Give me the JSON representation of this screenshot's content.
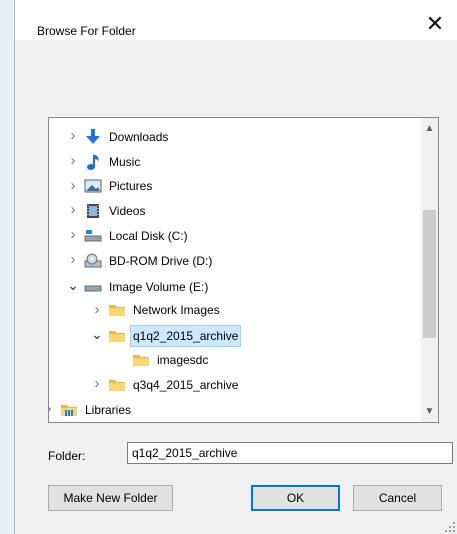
{
  "dialog": {
    "title": "Browse For Folder",
    "close_glyph": "✕"
  },
  "tree": {
    "items": [
      {
        "label": "Downloads",
        "icon": "downloads-icon",
        "level": 1,
        "expanded": false,
        "selected": false
      },
      {
        "label": "Music",
        "icon": "music-icon",
        "level": 1,
        "expanded": false,
        "selected": false
      },
      {
        "label": "Pictures",
        "icon": "pictures-icon",
        "level": 1,
        "expanded": false,
        "selected": false
      },
      {
        "label": "Videos",
        "icon": "videos-icon",
        "level": 1,
        "expanded": false,
        "selected": false
      },
      {
        "label": "Local Disk (C:)",
        "icon": "local-disk-icon",
        "level": 1,
        "expanded": false,
        "selected": false
      },
      {
        "label": "BD-ROM Drive (D:)",
        "icon": "bd-rom-icon",
        "level": 1,
        "expanded": false,
        "selected": false
      },
      {
        "label": "Image Volume (E:)",
        "icon": "drive-icon",
        "level": 1,
        "expanded": true,
        "selected": false
      },
      {
        "label": "Network Images",
        "icon": "folder-icon",
        "level": 2,
        "expanded": false,
        "selected": false
      },
      {
        "label": "q1q2_2015_archive",
        "icon": "folder-icon",
        "level": 2,
        "expanded": true,
        "selected": true
      },
      {
        "label": "imagesdc",
        "icon": "folder-icon",
        "level": 3,
        "expanded": null,
        "selected": false
      },
      {
        "label": "q3q4_2015_archive",
        "icon": "folder-icon",
        "level": 2,
        "expanded": false,
        "selected": false
      },
      {
        "label": "Libraries",
        "icon": "libraries-icon",
        "level": 0,
        "expanded": false,
        "selected": false
      }
    ]
  },
  "folder": {
    "label": "Folder:",
    "value": "q1q2_2015_archive"
  },
  "buttons": {
    "make_new_folder": "Make New Folder",
    "ok": "OK",
    "cancel": "Cancel"
  },
  "colors": {
    "accent": "#0078d7",
    "selection": "#cce8ff",
    "folder": "#f8d775"
  }
}
